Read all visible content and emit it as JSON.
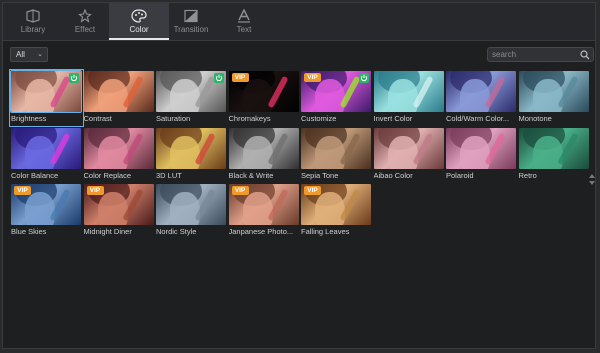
{
  "tabs": [
    {
      "label": "Library",
      "icon": "library-icon",
      "active": false
    },
    {
      "label": "Effect",
      "icon": "effect-icon",
      "active": false
    },
    {
      "label": "Color",
      "icon": "palette-icon",
      "active": true
    },
    {
      "label": "Transition",
      "icon": "transition-icon",
      "active": false
    },
    {
      "label": "Text",
      "icon": "text-icon",
      "active": false
    }
  ],
  "filter": {
    "value": "All"
  },
  "search": {
    "placeholder": "search"
  },
  "badges": {
    "vip_label": "VIP"
  },
  "presets": [
    {
      "label": "Brightness",
      "vip": false,
      "downloaded": true,
      "selected": true,
      "tint": [
        "#e7b7a6",
        "#7b4a3e",
        "#d94a8a"
      ]
    },
    {
      "label": "Contrast",
      "vip": false,
      "downloaded": false,
      "tint": [
        "#f0a07a",
        "#5a2a1c",
        "#e0603a"
      ]
    },
    {
      "label": "Saturation",
      "vip": false,
      "downloaded": true,
      "tint": [
        "#cfcfcf",
        "#555555",
        "#9a9a9a"
      ]
    },
    {
      "label": "Chromakeys",
      "vip": true,
      "downloaded": false,
      "tint": [
        "#1a1010",
        "#000000",
        "#e03060"
      ]
    },
    {
      "label": "Customize",
      "vip": true,
      "downloaded": true,
      "tint": [
        "#e05adf",
        "#3a1a6a",
        "#a0e030"
      ]
    },
    {
      "label": "Invert Color",
      "vip": false,
      "downloaded": false,
      "tint": [
        "#9ae0e0",
        "#2a7a8a",
        "#d0f0f0"
      ]
    },
    {
      "label": "Cold/Warm Color...",
      "vip": false,
      "downloaded": false,
      "tint": [
        "#8a9ad8",
        "#2a2a6a",
        "#c06a9a"
      ]
    },
    {
      "label": "Monotone",
      "vip": false,
      "downloaded": false,
      "tint": [
        "#8ab8c8",
        "#2a4a5a",
        "#5a8a9a"
      ]
    },
    {
      "label": "Color Balance",
      "vip": false,
      "downloaded": false,
      "tint": [
        "#6a6ae0",
        "#2a1a7a",
        "#e03ae0"
      ]
    },
    {
      "label": "Color Replace",
      "vip": false,
      "downloaded": false,
      "tint": [
        "#e08aa0",
        "#5a2a3a",
        "#c04a7a"
      ]
    },
    {
      "label": "3D LUT",
      "vip": false,
      "downloaded": false,
      "tint": [
        "#e0c060",
        "#6a3a1a",
        "#d04a3a"
      ]
    },
    {
      "label": "Black & Write",
      "vip": false,
      "downloaded": false,
      "tint": [
        "#b0b0b0",
        "#303030",
        "#707070"
      ]
    },
    {
      "label": "Sepia Tone",
      "vip": false,
      "downloaded": false,
      "tint": [
        "#c09a7a",
        "#4a3020",
        "#8a6a4a"
      ]
    },
    {
      "label": "Aibao Color",
      "vip": false,
      "downloaded": false,
      "tint": [
        "#e0b0b0",
        "#6a3a3a",
        "#c07a8a"
      ]
    },
    {
      "label": "Polaroid",
      "vip": false,
      "downloaded": false,
      "tint": [
        "#e0a0c0",
        "#7a3a5a",
        "#e06a9a"
      ]
    },
    {
      "label": "Retro",
      "vip": false,
      "downloaded": false,
      "tint": [
        "#4ab08a",
        "#1a4a3a",
        "#2a8a6a"
      ]
    },
    {
      "label": "Blue Skies",
      "vip": true,
      "downloaded": false,
      "tint": [
        "#7aa0d0",
        "#1a3a6a",
        "#4a7ab0"
      ]
    },
    {
      "label": "Midnight Diner",
      "vip": true,
      "downloaded": false,
      "tint": [
        "#d0806a",
        "#4a1a1a",
        "#a04a3a"
      ]
    },
    {
      "label": "Nordic Style",
      "vip": false,
      "downloaded": false,
      "tint": [
        "#a0b0c0",
        "#3a4a5a",
        "#7a8a9a"
      ]
    },
    {
      "label": "Janpanese Photo...",
      "vip": true,
      "downloaded": false,
      "tint": [
        "#e0a08a",
        "#6a3a2a",
        "#c06a5a"
      ]
    },
    {
      "label": "Falling Leaves",
      "vip": true,
      "downloaded": false,
      "tint": [
        "#e0b07a",
        "#6a3a1a",
        "#c08a4a"
      ]
    }
  ]
}
